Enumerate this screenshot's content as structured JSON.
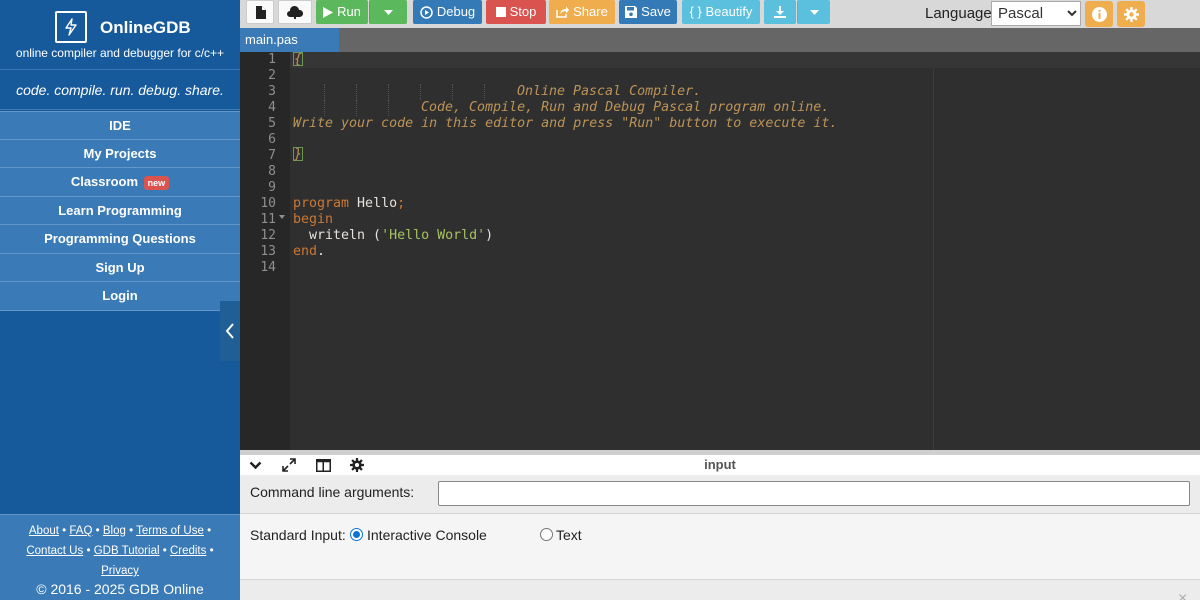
{
  "brand": {
    "name": "OnlineGDB",
    "subtitle": "online compiler and debugger for c/c++",
    "tagline": "code. compile. run. debug. share."
  },
  "nav": {
    "items": [
      {
        "label": "IDE"
      },
      {
        "label": "My Projects"
      },
      {
        "label": "Classroom",
        "badge": "new"
      },
      {
        "label": "Learn Programming"
      },
      {
        "label": "Programming Questions"
      },
      {
        "label": "Sign Up"
      },
      {
        "label": "Login"
      }
    ]
  },
  "footer": {
    "about": "About",
    "faq": "FAQ",
    "blog": "Blog",
    "terms": "Terms of Use",
    "contact": "Contact Us",
    "gdb_tutorial": "GDB Tutorial",
    "credits": "Credits",
    "privacy": "Privacy",
    "separator": "•",
    "copyright": "© 2016 - 2025 GDB Online"
  },
  "toolbar": {
    "run_label": "Run",
    "debug_label": "Debug",
    "stop_label": "Stop",
    "share_label": "Share",
    "save_label": "Save",
    "beautify_label": "{ } Beautify",
    "language_label": "Language",
    "language_selected": "Pascal",
    "colors": {
      "run": "#5cb85c",
      "debug": "#337ab7",
      "stop": "#d9534f",
      "share": "#f0ad4e",
      "save": "#337ab7",
      "beautify": "#5bc0de",
      "download": "#5bc0de"
    }
  },
  "file_tab": "main.pas",
  "editor": {
    "line_numbers": [
      "1",
      "2",
      "3",
      "4",
      "5",
      "6",
      "7",
      "8",
      "9",
      "10",
      "11",
      "12",
      "13",
      "14"
    ],
    "comment_open": "{",
    "comment_line3": "Online Pascal Compiler.",
    "comment_line4": "Code, Compile, Run and Debug Pascal program online.",
    "comment_line5": "Write your code in this editor and press \"Run\" button to execute it.",
    "comment_close": "}",
    "kw_program": "program",
    "program_name": " Hello",
    "semicolon": ";",
    "kw_begin": "begin",
    "call_name": "  writeln (",
    "call_string": "'Hello World'",
    "call_close": ")",
    "kw_end": "end",
    "end_dot": "."
  },
  "io_panel": {
    "title": "input",
    "cmd_label": "Command line arguments:",
    "cmd_value": "",
    "stdin_label": "Standard Input:",
    "option_interactive": "Interactive Console",
    "option_text": "Text",
    "selected": "Interactive Console",
    "close_glyph": "×"
  }
}
